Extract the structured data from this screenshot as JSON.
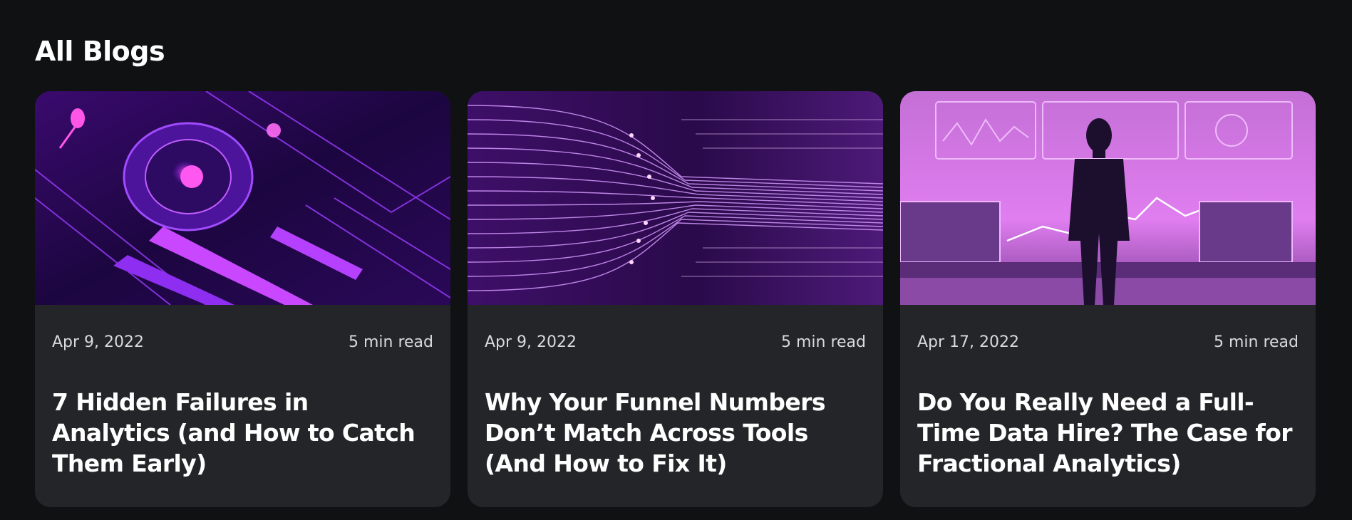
{
  "section": {
    "title": "All Blogs"
  },
  "posts": [
    {
      "date": "Apr 9, 2022",
      "read_time": "5 min read",
      "title": "7 Hidden Failures in Analytics (and How to Catch Them Early)",
      "image": "abstract-purple-machinery-illustration"
    },
    {
      "date": "Apr 9, 2022",
      "read_time": "5 min read",
      "title": "Why Your Funnel Numbers Don’t Match Across Tools (And How to Fix It)",
      "image": "glowing-converging-lines-illustration"
    },
    {
      "date": "Apr 17, 2022",
      "read_time": "5 min read",
      "title": "Do You Really Need a Full-Time Data Hire? The Case for Fractional Analytics)",
      "image": "person-facing-data-dashboards-illustration"
    }
  ],
  "colors": {
    "background": "#101113",
    "card": "#242528",
    "accent": "#b535f6"
  }
}
